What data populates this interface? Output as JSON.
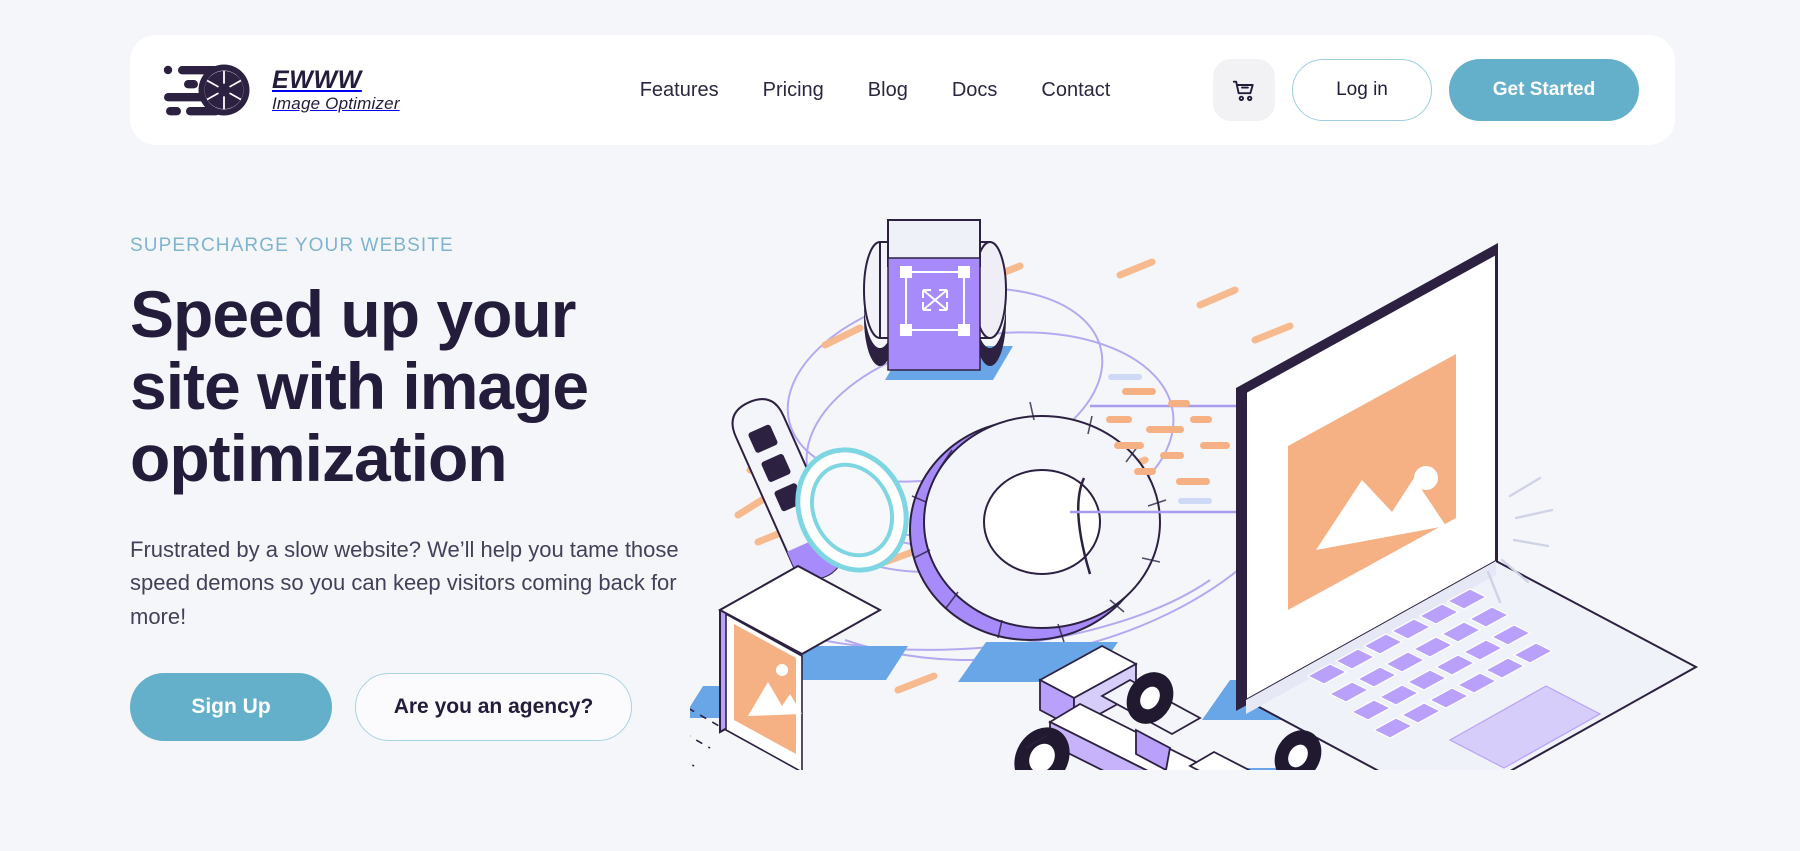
{
  "theme": {
    "page_background": "#f5f6fa",
    "accent_teal": "#64b0cb",
    "accent_teal_light": "#7fb4cf",
    "ink": "#241c3b",
    "illustration_purple": "#a78bfa",
    "illustration_orange": "#f5b183",
    "illustration_blue": "#6ea8e8"
  },
  "header": {
    "brand": {
      "name": "EWWW",
      "tagline": "Image Optimizer",
      "logo_icon": "camera-aperture-speed-icon"
    },
    "nav": [
      {
        "label": "Features"
      },
      {
        "label": "Pricing"
      },
      {
        "label": "Blog"
      },
      {
        "label": "Docs"
      },
      {
        "label": "Contact"
      }
    ],
    "cart_icon": "shopping-cart-icon",
    "login_label": "Log in",
    "get_started_label": "Get Started"
  },
  "hero": {
    "eyebrow": "SUPERCHARGE YOUR WEBSITE",
    "headline_line1": "Speed up your",
    "headline_line2": "site with image",
    "headline_line3": "optimization",
    "subcopy": "Frustrated by a slow website? We’ll help you tame those speed demons so you can keep visitors coming back for more!",
    "primary_cta": "Sign Up",
    "secondary_cta": "Are you an agency?",
    "illustration_alt": "isometric-image-optimization-illustration"
  }
}
